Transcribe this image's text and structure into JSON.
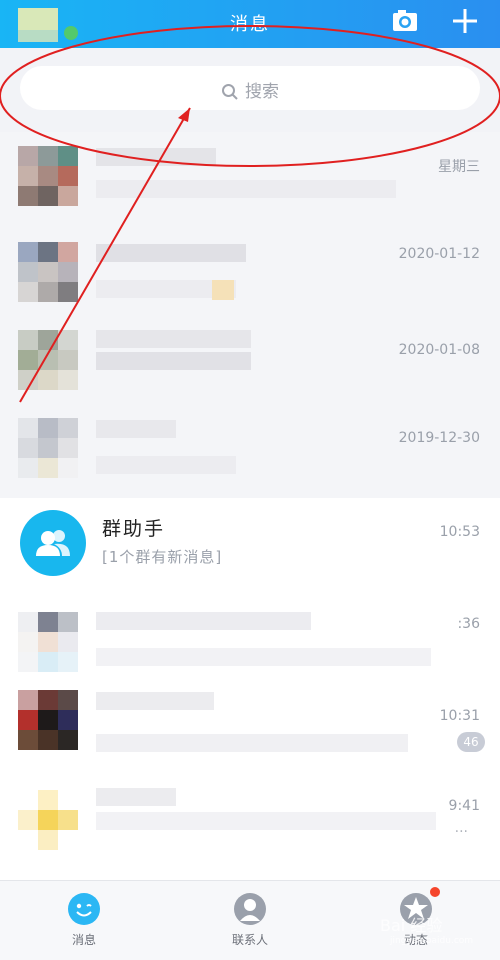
{
  "header": {
    "title": "消息",
    "camera_icon": "camera-icon",
    "plus_icon": "plus-icon"
  },
  "search": {
    "placeholder": "搜索",
    "icon": "search-icon"
  },
  "conversations_blurred": [
    {
      "time": "星期三"
    },
    {
      "time": "2020-01-12"
    },
    {
      "time": "2020-01-08"
    },
    {
      "time": "2019-12-30"
    }
  ],
  "group_assistant": {
    "name": "群助手",
    "subtitle": "[1个群有新消息]",
    "time": "10:53",
    "icon": "group-icon"
  },
  "conversations_lower": [
    {
      "time": ":36"
    },
    {
      "time": "10:31",
      "badge": "46"
    },
    {
      "time": "9:41",
      "more": "..."
    }
  ],
  "tabbar": {
    "items": [
      {
        "label": "消息",
        "icon": "message-icon"
      },
      {
        "label": "联系人",
        "icon": "contacts-icon"
      },
      {
        "label": "动态",
        "icon": "star-icon"
      }
    ]
  },
  "watermark": {
    "text": "Bai 经验",
    "sub": "jingyan.baidu.com"
  },
  "colors": {
    "header": "#19b5f5",
    "accent": "#18b7ee",
    "annotation": "#e02020",
    "badge": "#c8ccd6"
  }
}
